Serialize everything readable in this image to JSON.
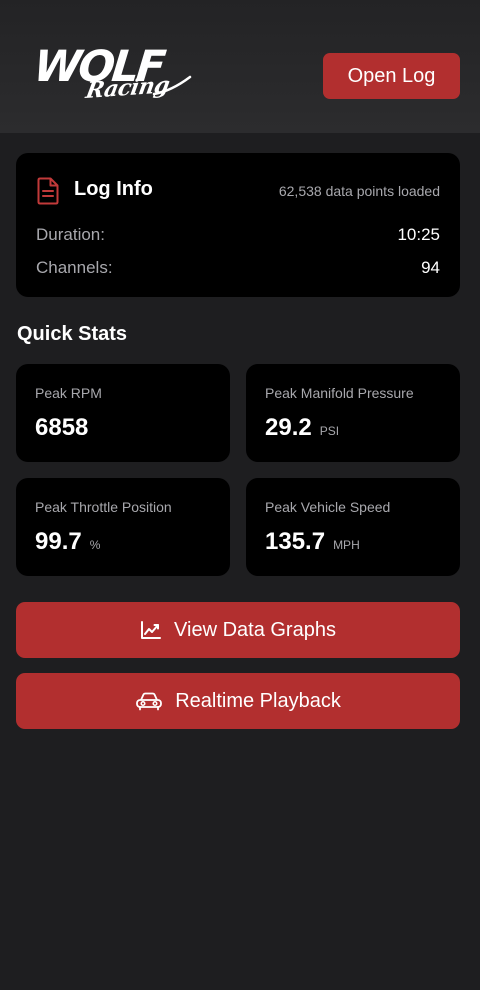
{
  "header": {
    "logo_primary": "WOLF",
    "logo_secondary": "Racing",
    "open_log_label": "Open Log"
  },
  "log_info": {
    "title": "Log Info",
    "data_points": "62,538 data points loaded",
    "duration_label": "Duration:",
    "duration_value": "10:25",
    "channels_label": "Channels:",
    "channels_value": "94"
  },
  "quick_stats": {
    "title": "Quick Stats",
    "items": [
      {
        "label": "Peak RPM",
        "value": "6858",
        "unit": ""
      },
      {
        "label": "Peak Manifold Pressure",
        "value": "29.2",
        "unit": "PSI"
      },
      {
        "label": "Peak Throttle Position",
        "value": "99.7",
        "unit": "%"
      },
      {
        "label": "Peak Vehicle Speed",
        "value": "135.7",
        "unit": "MPH"
      }
    ]
  },
  "actions": {
    "graphs_label": "View Data Graphs",
    "graphs_icon": "chart-line-icon",
    "playback_label": "Realtime Playback",
    "playback_icon": "car-icon"
  },
  "colors": {
    "accent": "#b22f2f",
    "background": "#1e1e20",
    "card": "#000000",
    "muted_text": "#a8a8ad"
  }
}
